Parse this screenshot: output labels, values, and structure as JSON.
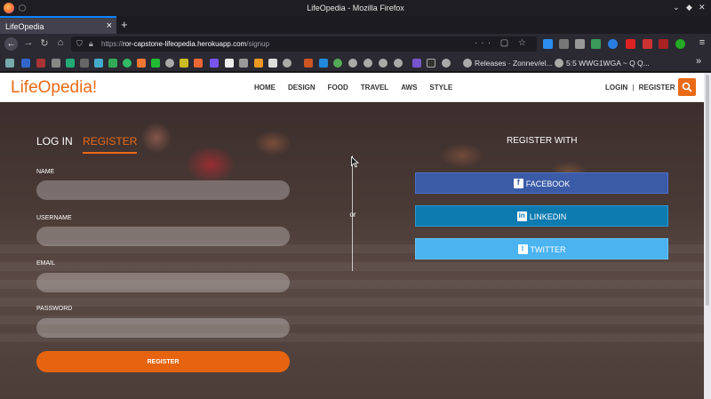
{
  "window": {
    "title": "LifeOpedia - Mozilla Firefox"
  },
  "tabs": [
    {
      "label": "LifeOpedia"
    }
  ],
  "urlbar": {
    "url_prefix": "https://",
    "url_host": "ror-capstone-lifeopedia.herokuapp.com",
    "url_path": "/signup"
  },
  "bookmarks": {
    "item1": "Releases · Zonnev/el...",
    "item2": "5:5 WWG1WGA ~ Q Q..."
  },
  "site": {
    "logo": "LifeOpedia!",
    "nav": [
      "HOME",
      "DESIGN",
      "FOOD",
      "TRAVEL",
      "AWS",
      "STYLE"
    ],
    "login": "LOGIN",
    "separator": "|",
    "register": "REGISTER"
  },
  "form": {
    "tab_login": "LOG IN",
    "tab_register": "REGISTER",
    "name_label": "NAME",
    "username_label": "USERNAME",
    "email_label": "EMAIL",
    "password_label": "PASSWORD",
    "submit_label": "REGISTER"
  },
  "divider_text": "or",
  "social": {
    "heading": "REGISTER WITH",
    "facebook": "FACEBOOK",
    "linkedin": "LINKEDIN",
    "twitter": "TWITTER"
  },
  "colors": {
    "accent": "#ea6a17",
    "facebook": "#3b5ba7",
    "linkedin": "#0d7ab0",
    "twitter": "#4ab3f0"
  }
}
